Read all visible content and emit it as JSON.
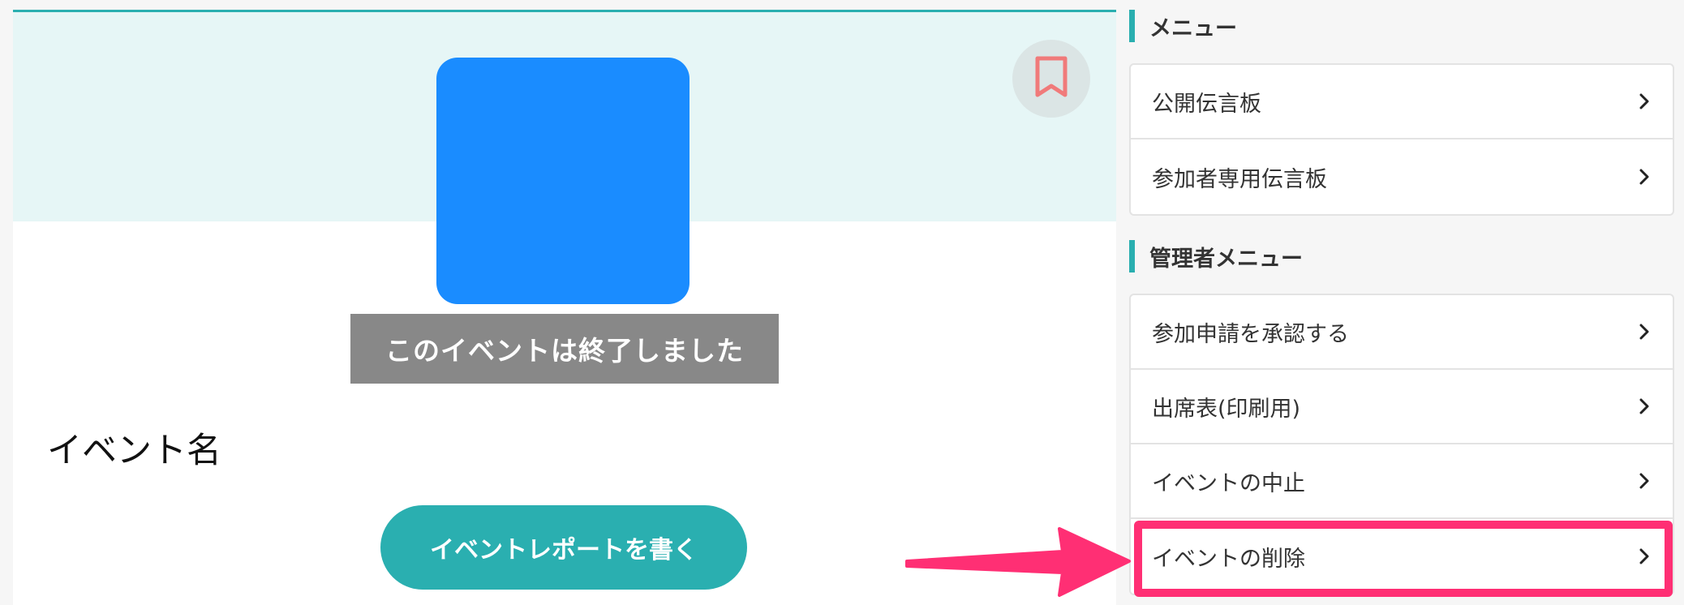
{
  "event": {
    "ended_banner": "このイベントは終了しました",
    "name": "イベント名",
    "report_button_label": "イベントレポートを書く"
  },
  "menu": {
    "title": "メニュー",
    "items": [
      {
        "label": "公開伝言板"
      },
      {
        "label": "参加者専用伝言板"
      }
    ]
  },
  "admin_menu": {
    "title": "管理者メニュー",
    "items": [
      {
        "label": "参加申請を承認する"
      },
      {
        "label": "出席表(印刷用)"
      },
      {
        "label": "イベントの中止"
      },
      {
        "label": "イベントの削除"
      }
    ]
  },
  "colors": {
    "accent_teal": "#2aafb0",
    "hero_background": "#e6f6f6",
    "event_image_blue": "#1a8cff",
    "ended_banner_gray": "#888888",
    "bookmark_pink": "#f07a7a",
    "highlight_pink": "#ff2f74"
  },
  "icons": {
    "bookmark": "bookmark-icon",
    "menu_chevron": "chevron-right-icon",
    "annotation_arrow": "arrow-right-icon"
  }
}
